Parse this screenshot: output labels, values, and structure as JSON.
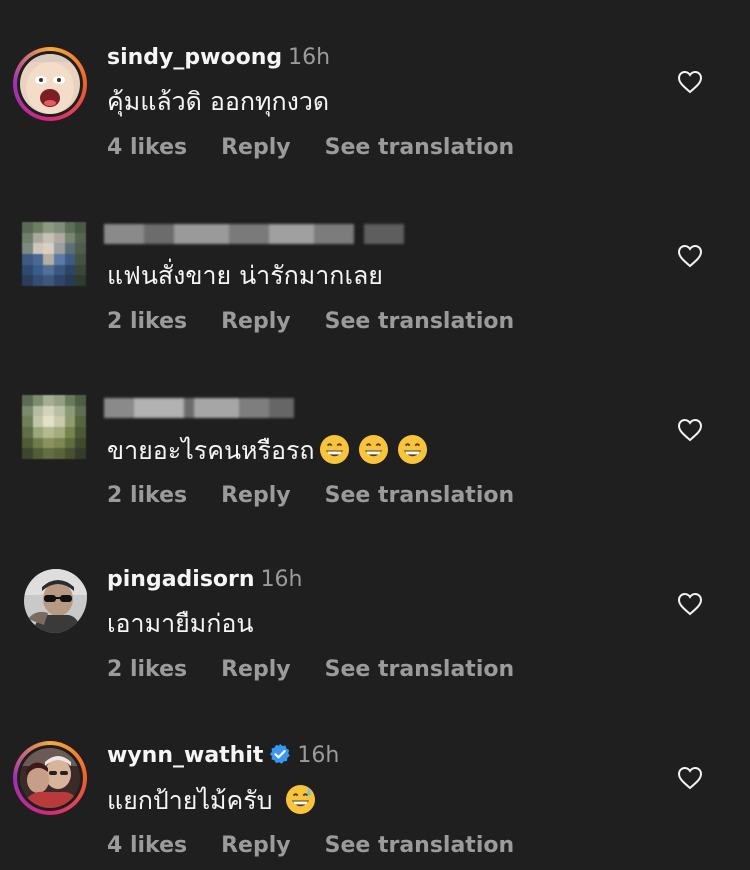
{
  "comments": [
    {
      "username": "sindy_pwoong",
      "time": "16h",
      "text": "คุ้มแล้วดิ ออกทุกงวด",
      "likes": "4 likes",
      "reply": "Reply",
      "translate": "See translation",
      "avatar_has_story_ring": true
    },
    {
      "username_blurred": true,
      "text": "แฟนสั่งขาย น่ารักมากเลย",
      "likes": "2 likes",
      "reply": "Reply",
      "translate": "See translation"
    },
    {
      "username_blurred": true,
      "text": "ขายอะไรคนหรือรถ",
      "emoji": [
        "grinning-face-emoji",
        "grinning-face-emoji",
        "grinning-face-emoji"
      ],
      "likes": "2 likes",
      "reply": "Reply",
      "translate": "See translation"
    },
    {
      "username": "pingadisorn",
      "time": "16h",
      "text": "เอามายืมก่อน",
      "likes": "2 likes",
      "reply": "Reply",
      "translate": "See translation",
      "avatar_has_story_ring": false
    },
    {
      "username": "wynn_wathit",
      "verified": true,
      "time": "16h",
      "text": "แยกป้ายไม้ครับ",
      "emoji": [
        "grinning-sweat-emoji"
      ],
      "likes": "4 likes",
      "reply": "Reply",
      "translate": "See translation",
      "avatar_has_story_ring": true
    }
  ],
  "colors": {
    "background": "#1f1f1f",
    "primary_text": "#f5f5f5",
    "secondary_text": "#9b9b9b",
    "verified_blue": "#3897f0"
  }
}
